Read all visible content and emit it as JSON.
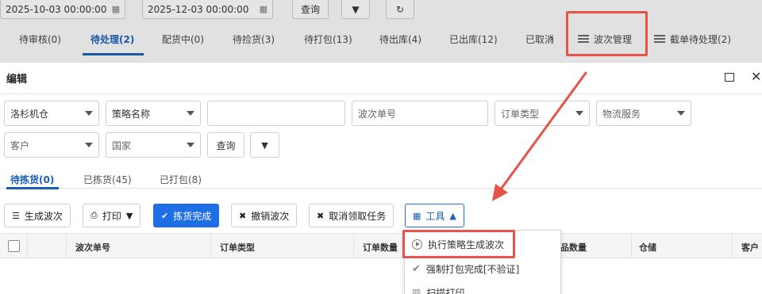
{
  "background": {
    "date_start": "2025-10-03 00:00:00",
    "date_end": "2025-12-03 00:00:00",
    "query_label": "查询",
    "tabs": [
      "待审核(0)",
      "待处理(2)",
      "配货中(0)",
      "待捡货(3)",
      "待打包(13)",
      "待出库(4)",
      "已出库(12)",
      "已取消"
    ],
    "wave_management": "波次管理",
    "cutoff_pending": "截单待处理(2)"
  },
  "modal": {
    "title": "编辑",
    "filters": {
      "warehouse": "洛杉机仓",
      "strategy": "策略名称",
      "blank_value": "",
      "wave_no_placeholder": "波次单号",
      "order_type": "订单类型",
      "logistics": "物流服务",
      "customer": "客户",
      "country": "国家",
      "query_label": "查询"
    },
    "tabs": [
      "待拣货(0)",
      "已拣货(45)",
      "已打包(8)"
    ],
    "toolbar": {
      "generate_wave": "生成波次",
      "print": "打印",
      "pick_complete": "拣货完成",
      "cancel_wave": "撤销波次",
      "cancel_claim": "取消领取任务",
      "tools": "工具"
    },
    "table_headers": [
      "波次单号",
      "订单类型",
      "订单数量",
      "品数量",
      "仓储",
      "客户"
    ],
    "tools_menu": [
      "执行策略生成波次",
      "强制打包完成[不验证]",
      "扫描打印"
    ]
  },
  "colors": {
    "primary": "#1e6fe6",
    "active_tab": "#1a5fb4",
    "annotation_red": "#e5534b"
  }
}
